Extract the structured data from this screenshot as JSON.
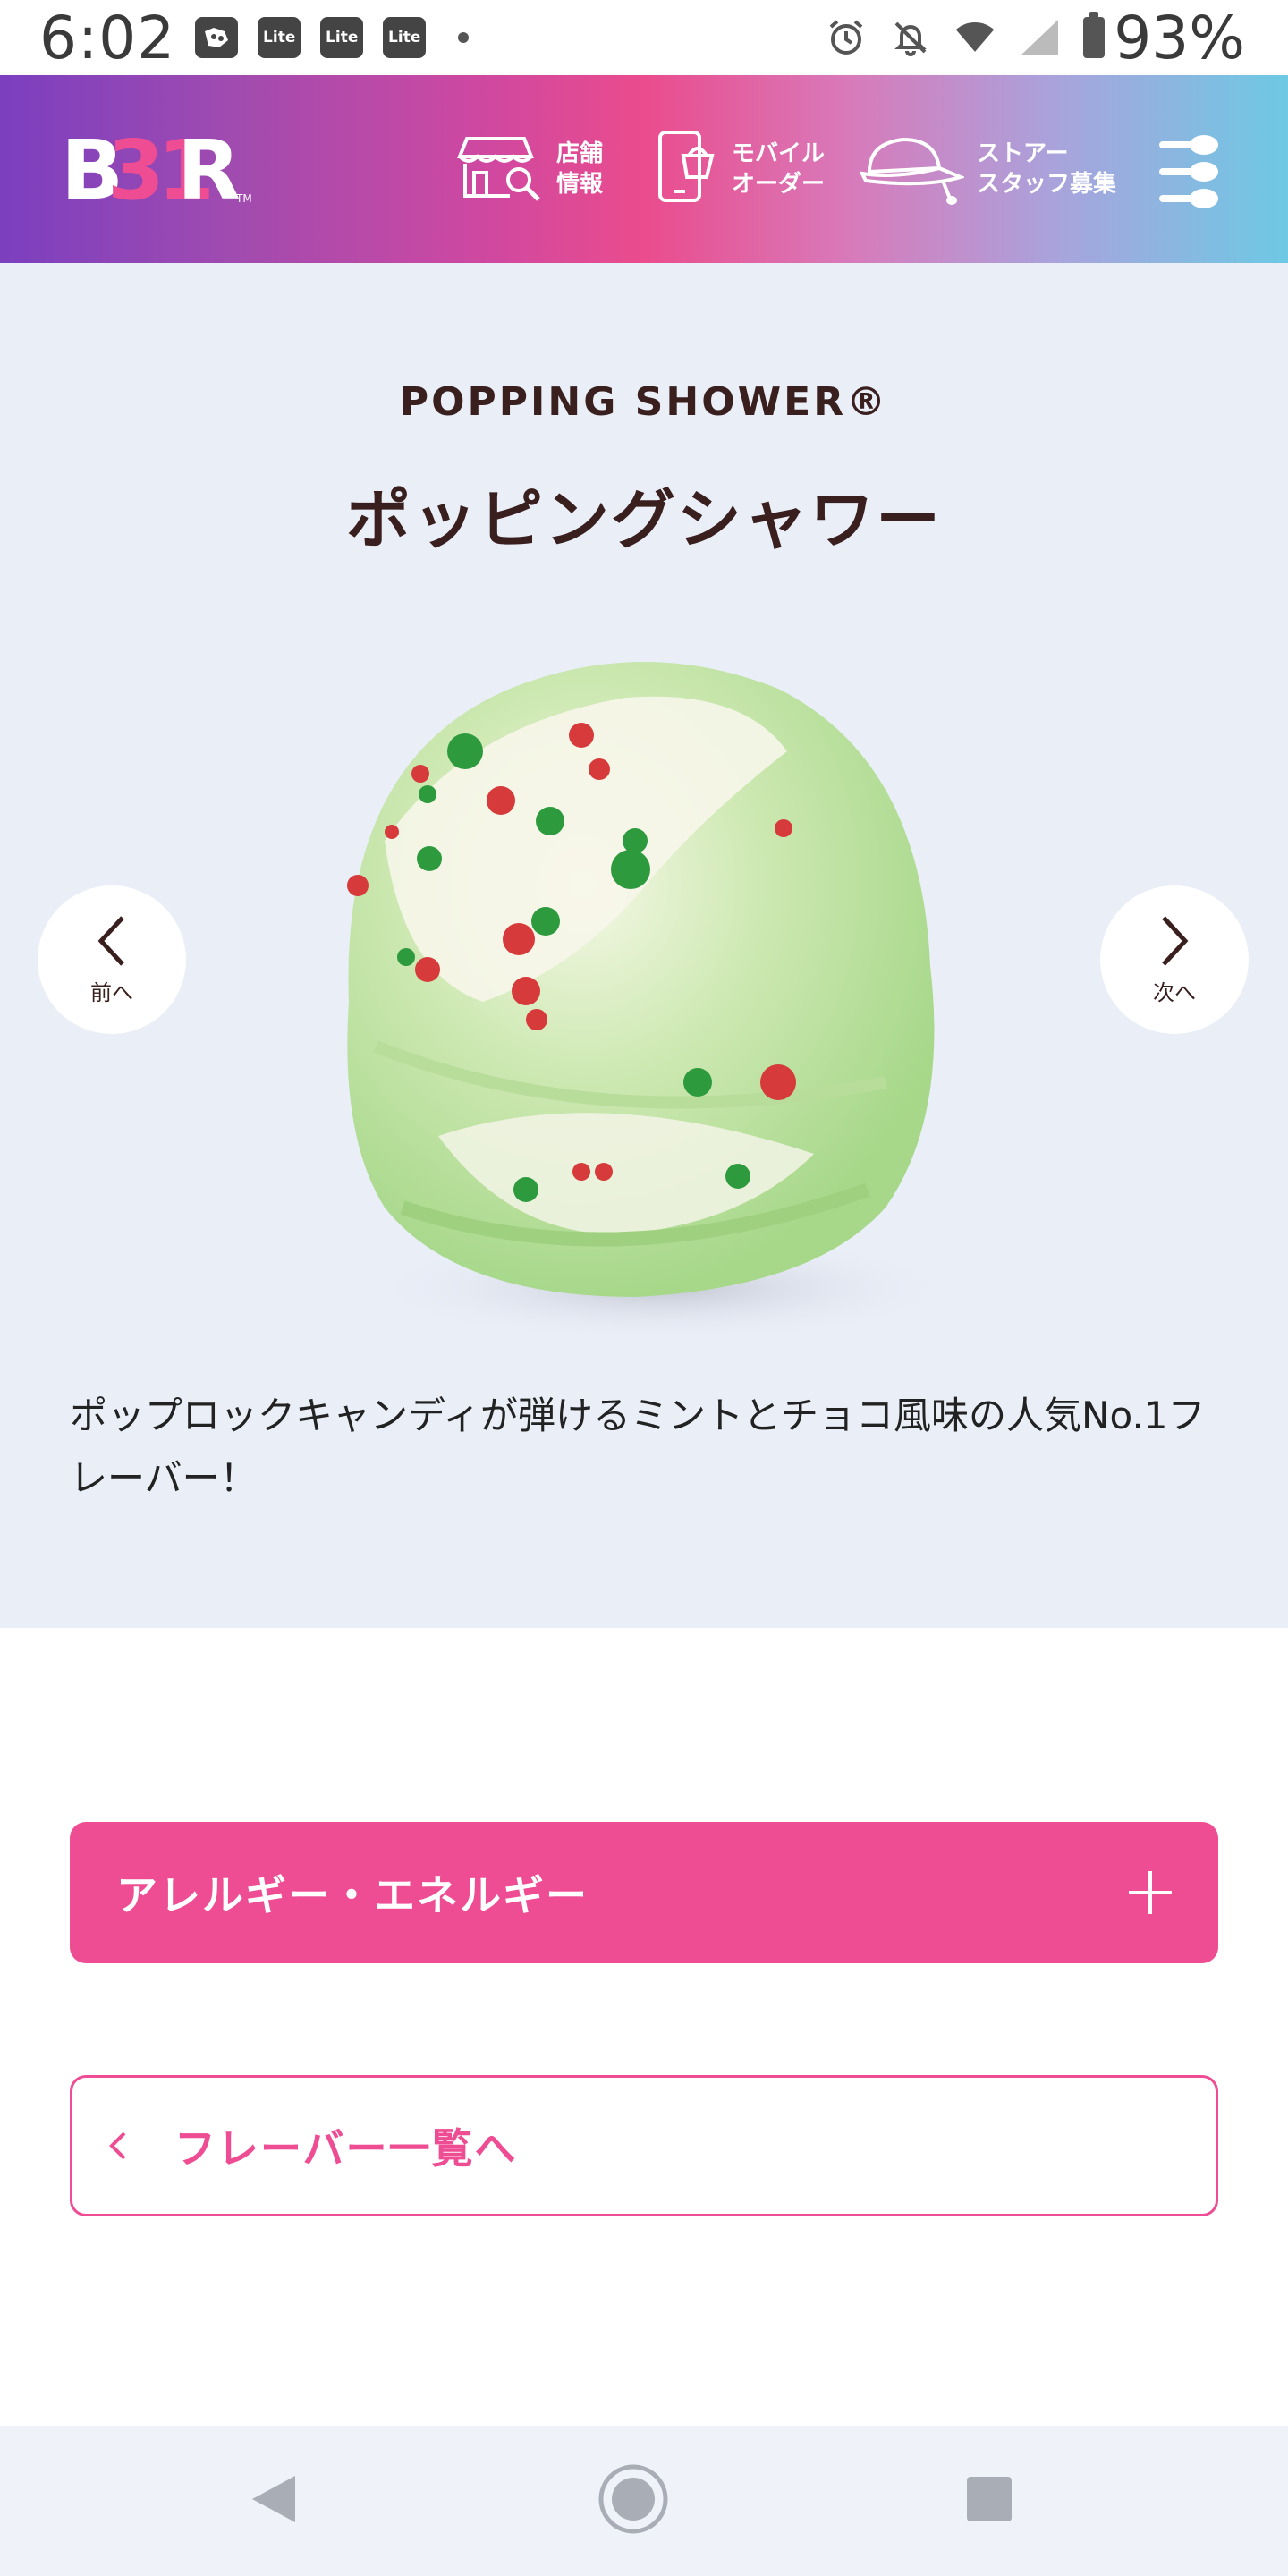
{
  "status_bar": {
    "time": "6:02",
    "app_icons": [
      "Lite",
      "Lite",
      "Lite"
    ],
    "battery": "93%",
    "icons": [
      "alarm-icon",
      "bell-off-icon",
      "wifi-icon",
      "signal-icon",
      "battery-icon"
    ]
  },
  "header": {
    "logo": "BR",
    "nav": {
      "store_label": "店舗\n情報",
      "mobile_label": "モバイル\nオーダー",
      "staff_label": "ストアー\nスタッフ募集"
    },
    "brand_colors": [
      "#7b3fbf",
      "#ea4c8d",
      "#6dc9e4"
    ]
  },
  "flavor": {
    "eyebrow": "POPPING SHOWER®",
    "title": "ポッピングシャワー",
    "description": "ポップロックキャンディが弾けるミントとチョコ風味の人気No.1フレーバー！",
    "prev_label": "前へ",
    "next_label": "次へ"
  },
  "actions": {
    "allergy_label": "アレルギー・エネルギー",
    "back_label": "フレーバー一覧へ"
  },
  "colors": {
    "accent_pink": "#ee4c93",
    "hero_bg": "#e9eef7",
    "text_dark": "#3a1f1f"
  }
}
